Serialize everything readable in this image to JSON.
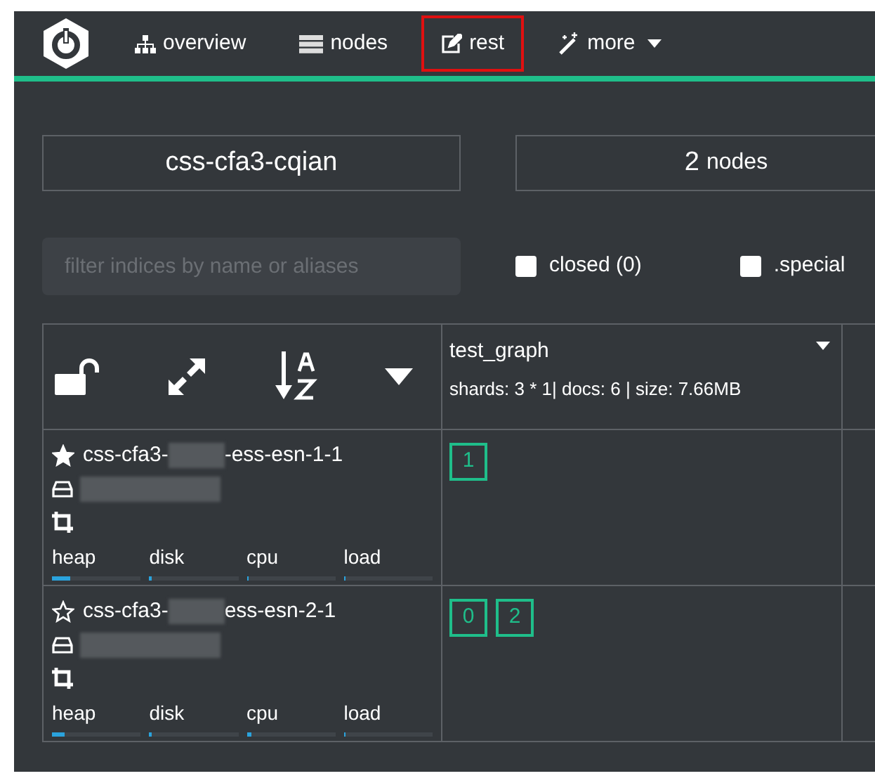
{
  "nav": {
    "items": [
      {
        "label": "overview",
        "highlighted": false,
        "dropdown": false
      },
      {
        "label": "nodes",
        "highlighted": false,
        "dropdown": false
      },
      {
        "label": "rest",
        "highlighted": true,
        "dropdown": false
      },
      {
        "label": "more",
        "highlighted": false,
        "dropdown": true
      }
    ]
  },
  "cluster": {
    "name": "css-cfa3-cqian",
    "node_count": "2",
    "node_label": "nodes"
  },
  "filter": {
    "placeholder": "filter indices by name or aliases",
    "checkboxes": [
      {
        "label": "closed (0)",
        "checked": false
      },
      {
        "label": ".special",
        "checked": false
      }
    ]
  },
  "table": {
    "indices": [
      {
        "name": "test_graph",
        "stats": "shards: 3 * 1| docs: 6 | size: 7.66MB"
      }
    ],
    "nodes": [
      {
        "name_start": "css-cfa3-",
        "name_end": "-ess-esn-1-1",
        "master": true,
        "metrics": [
          {
            "label": "heap",
            "level": 0.2
          },
          {
            "label": "disk",
            "level": 0.02
          },
          {
            "label": "cpu",
            "level": 0.02
          },
          {
            "label": "load",
            "level": 0.02
          }
        ],
        "shards": [
          [
            "1"
          ]
        ]
      },
      {
        "name_start": "css-cfa3-",
        "name_end": "ess-esn-2-1",
        "master": false,
        "metrics": [
          {
            "label": "heap",
            "level": 0.15
          },
          {
            "label": "disk",
            "level": 0.02
          },
          {
            "label": "cpu",
            "level": 0.06
          },
          {
            "label": "load",
            "level": 0.02
          }
        ],
        "shards": [
          [
            "0",
            "2"
          ]
        ]
      }
    ]
  }
}
